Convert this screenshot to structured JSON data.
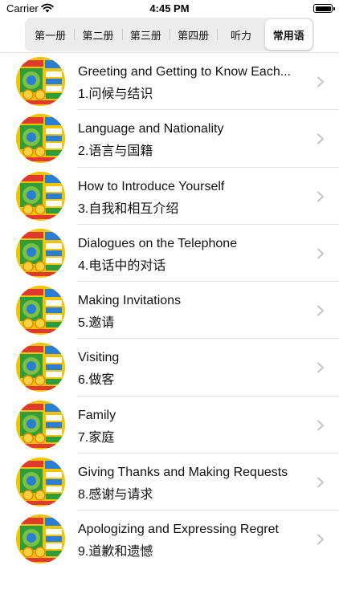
{
  "status_bar": {
    "carrier": "Carrier",
    "time": "4:45 PM",
    "wifi_icon": "wifi-icon",
    "battery_icon": "battery-icon"
  },
  "tabs": [
    {
      "label": "第一册",
      "selected": false
    },
    {
      "label": "第二册",
      "selected": false
    },
    {
      "label": "第三册",
      "selected": false
    },
    {
      "label": "第四册",
      "selected": false
    },
    {
      "label": "听力",
      "selected": false
    },
    {
      "label": "常用语",
      "selected": true
    }
  ],
  "lessons": [
    {
      "title": "Greeting and Getting to Know Each...",
      "subtitle": "1.问候与结识"
    },
    {
      "title": "Language and Nationality",
      "subtitle": "2.语言与国籍"
    },
    {
      "title": "How to Introduce Yourself",
      "subtitle": "3.自我和相互介绍"
    },
    {
      "title": "Dialogues on the Telephone",
      "subtitle": "4.电话中的对话"
    },
    {
      "title": "Making Invitations",
      "subtitle": "5.邀请"
    },
    {
      "title": "Visiting",
      "subtitle": "6.做客"
    },
    {
      "title": "Family",
      "subtitle": "7.家庭"
    },
    {
      "title": "Giving Thanks and Making Requests",
      "subtitle": "8.感谢与请求"
    },
    {
      "title": "Apologizing and Expressing Regret",
      "subtitle": "9.道歉和遗憾"
    }
  ],
  "colors": {
    "thumbnail_yellow": "#f2c400",
    "thumbnail_green": "#2f9e3a",
    "thumbnail_blue": "#2a7fd4",
    "chevron": "#c4c4c7"
  }
}
